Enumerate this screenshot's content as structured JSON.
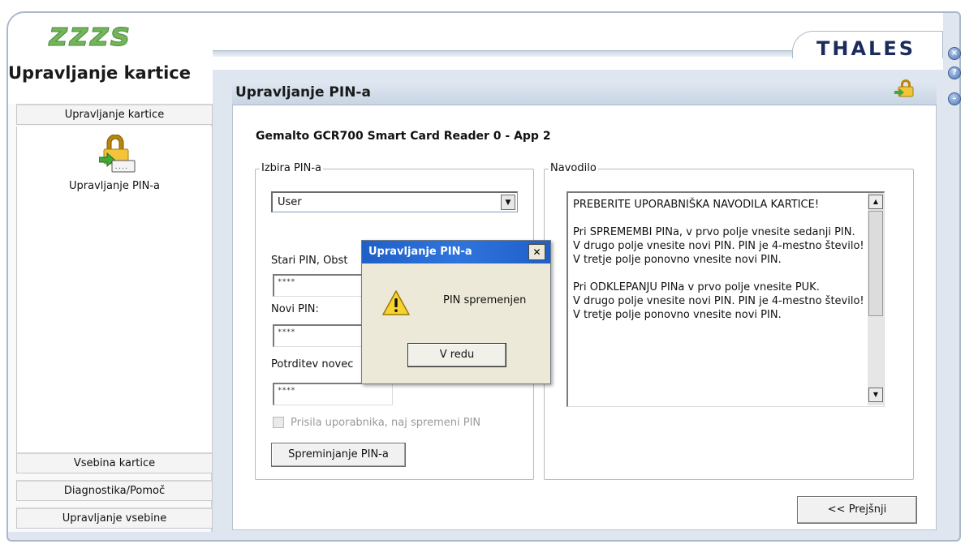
{
  "app": {
    "logo_text": "zzzs",
    "title": "Upravljanje kartice",
    "brand": "THALES",
    "window_controls": [
      "close-icon",
      "help-icon",
      "minimize-icon"
    ]
  },
  "nav": {
    "top_tab": "Upravljanje kartice",
    "items": [
      {
        "label": "Upravljanje PIN-a",
        "icon": "pin-lock-icon"
      }
    ],
    "bottom_tabs": [
      "Vsebina kartice",
      "Diagnostika/Pomoč",
      "Upravljanje vsebine"
    ]
  },
  "main": {
    "title": "Upravljanje PIN-a",
    "reader": "Gemalto GCR700 Smart Card Reader 0 - App 2",
    "pin_group": {
      "legend": "Izbira PIN-a",
      "select_value": "User",
      "old_pin_label": "Stari PIN, Obst",
      "old_pin_value": "****",
      "new_pin_label": "Novi PIN:",
      "new_pin_value": "****",
      "confirm_label": "Potrditev novec",
      "confirm_value": "****",
      "force_change_label": "Prisila uporabnika, naj spremeni PIN",
      "change_button": "Spreminjanje PIN-a"
    },
    "instructions": {
      "legend": "Navodilo",
      "text": "PREBERITE UPORABNIŠKA NAVODILA KARTICE!\n\nPri SPREMEMBI PINa, v prvo polje vnesite sedanji PIN.\nV drugo polje vnesite novi PIN. PIN je 4-mestno število!\nV tretje polje ponovno vnesite novi PIN.\n\nPri ODKLEPANJU PINa v prvo polje vnesite PUK.\nV drugo polje vnesite novi PIN. PIN je 4-mestno število!\nV tretje polje ponovno vnesite novi PIN."
    },
    "prev_button": "<< Prejšnji"
  },
  "dialog": {
    "title": "Upravljanje PIN-a",
    "close": "✕",
    "message": "PIN spremenjen",
    "ok_button": "V redu"
  },
  "colors": {
    "frame": "#dfe6ef",
    "dialog_title": "#2f74dd",
    "brand": "#1b2c5c",
    "logo": "#72b55a"
  }
}
